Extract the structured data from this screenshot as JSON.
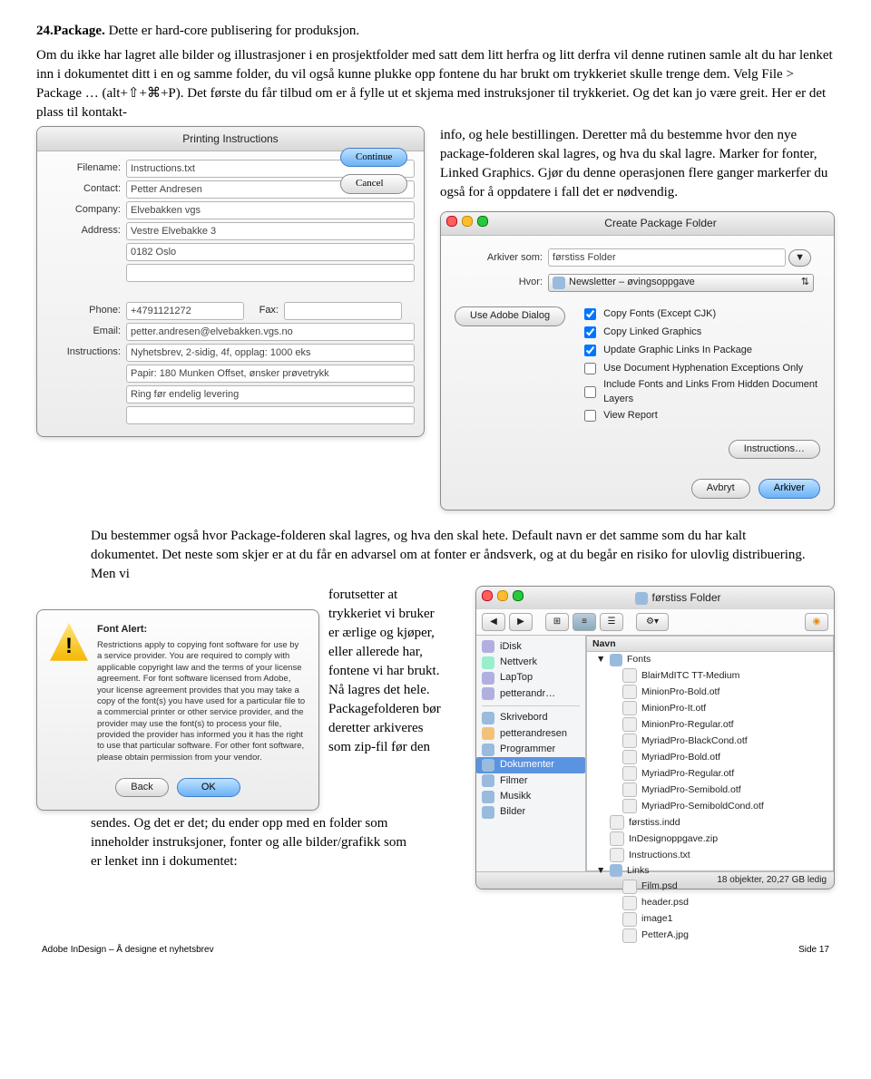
{
  "step": {
    "num": "24.",
    "title": "Package.",
    "rest": " Dette er hard-core publisering for produksjon."
  },
  "para1": "Om du ikke har lagret alle bilder og illustrasjoner i en prosjektfolder med satt dem litt herfra og litt derfra vil denne rutinen samle alt du har lenket inn i dokumentet ditt i en og samme folder, du vil også kunne plukke opp fontene du har brukt om trykkeriet skulle trenge dem. Velg File > Package … (alt+⇧+⌘+P). Det første du får tilbud om er å fylle ut et skjema med instruksjoner til trykkeriet. Og det kan jo være greit. Her er det plass til kontakt-",
  "para1b": "info, og hele bestillingen. Deretter må du bestemme hvor den nye package-folderen skal lagres, og hva du skal lagre. Marker for fonter, Linked Graphics. Gjør du denne operasjonen flere ganger markerfer du også for å oppdatere i fall det er nødvendig.",
  "printDlg": {
    "title": "Printing Instructions",
    "labels": {
      "filename": "Filename:",
      "contact": "Contact:",
      "company": "Company:",
      "address": "Address:",
      "phone": "Phone:",
      "fax": "Fax:",
      "email": "Email:",
      "instructions": "Instructions:"
    },
    "vals": {
      "filename": "Instructions.txt",
      "contact": "Petter Andresen",
      "company": "Elvebakken vgs",
      "addr1": "Vestre Elvebakke 3",
      "addr2": "0182 Oslo",
      "addr3": "",
      "phone": "+4791121272",
      "fax": "",
      "email": "petter.andresen@elvebakken.vgs.no",
      "inst1": "Nyhetsbrev, 2-sidig, 4f, opplag: 1000 eks",
      "inst2": "Papir: 180 Munken Offset, ønsker prøvetrykk",
      "inst3": "Ring før endelig levering",
      "inst4": ""
    },
    "buttons": {
      "continue": "Continue",
      "cancel": "Cancel"
    }
  },
  "pkgDlg": {
    "title": "Create Package Folder",
    "saveAsLabel": "Arkiver som:",
    "saveAs": "førstiss Folder",
    "whereLabel": "Hvor:",
    "where": "Newsletter – øvingsoppgave",
    "useAdobe": "Use Adobe Dialog",
    "opts": [
      "Copy Fonts (Except CJK)",
      "Copy Linked Graphics",
      "Update Graphic Links In Package",
      "Use Document Hyphenation Exceptions Only",
      "Include Fonts and Links From Hidden Document Layers",
      "View Report"
    ],
    "checked": [
      true,
      true,
      true,
      false,
      false,
      false
    ],
    "instructionsBtn": "Instructions…",
    "cancel": "Avbryt",
    "save": "Arkiver"
  },
  "para2": "Du bestemmer også hvor Package-folderen skal lagres, og hva den skal hete. Default navn er det samme som du har kalt dokumentet. Det neste som skjer er at du får en advarsel om at fonter er åndsverk, og at du begår en risiko for ulovlig distribuering. Men vi ",
  "para2b": "forutsetter at trykkeriet vi bruker er ærlige og kjøper, eller allerede har, fontene vi har brukt. Nå lagres det hele. Packagefolderen bør deretter arkiveres som zip-fil før den ",
  "para2c": "sendes. Og det er det; du ender opp med en folder som inneholder instruksjoner, fonter og alle bilder/grafikk som er lenket inn i dokumentet:",
  "fontAlert": {
    "title": "Font Alert:",
    "body": "Restrictions apply to copying font software for use by a service provider. You are required to comply with applicable copyright law and the terms of your license agreement. For font software licensed from Adobe, your license agreement provides that you may take a copy of the font(s) you have used for a particular file to a commercial printer or other service provider, and the provider may use the font(s) to process your file, provided the provider has informed you it has the right to use that particular software. For other font software, please obtain permission from your vendor.",
    "back": "Back",
    "ok": "OK"
  },
  "finder": {
    "title": "førstiss Folder",
    "sidebar": [
      "iDisk",
      "Nettverk",
      "LapTop",
      "petterandr…",
      "Skrivebord",
      "petterandresen",
      "Programmer",
      "Dokumenter",
      "Filmer",
      "Musikk",
      "Bilder"
    ],
    "selected": 7,
    "col3hdr": "Navn",
    "items": [
      "Fonts",
      "BlairMdITC TT-Medium",
      "MinionPro-Bold.otf",
      "MinionPro-It.otf",
      "MinionPro-Regular.otf",
      "MyriadPro-BlackCond.otf",
      "MyriadPro-Bold.otf",
      "MyriadPro-Regular.otf",
      "MyriadPro-Semibold.otf",
      "MyriadPro-SemiboldCond.otf",
      "førstiss.indd",
      "InDesignoppgave.zip",
      "Instructions.txt",
      "Links",
      "Film.psd",
      "header.psd",
      "image1",
      "PetterA.jpg"
    ],
    "status": "18 objekter, 20,27 GB ledig"
  },
  "footer": {
    "left": "Adobe InDesign – Å designe et nyhetsbrev",
    "right": "Side 17"
  }
}
